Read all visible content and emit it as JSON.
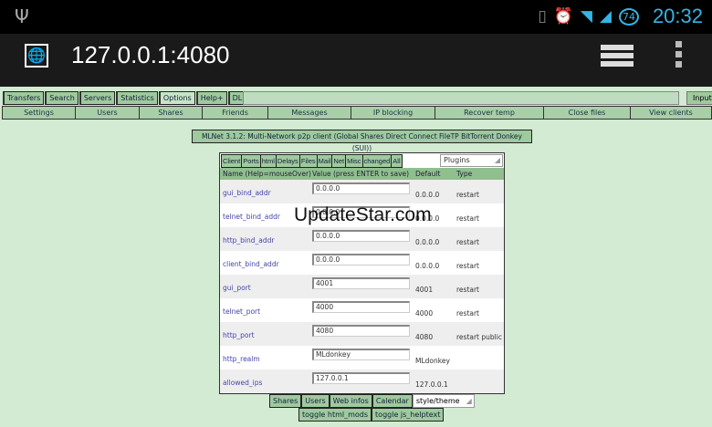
{
  "status": {
    "time": "20:32",
    "battery": "74"
  },
  "browser": {
    "url": "127.0.0.1:4080"
  },
  "nav1": [
    "Transfers",
    "Search",
    "Servers",
    "Statistics",
    "Options",
    "Help+",
    "DL"
  ],
  "input_label": "Input",
  "nav2": [
    "Settings",
    "Users",
    "Shares",
    "Friends",
    "Messages",
    "IP blocking",
    "Recover temp",
    "Close files",
    "View clients"
  ],
  "title": "MLNet 3.1.2: Multi-Network p2p client (Global Shares Direct Connect FileTP BitTorrent Donkey (SUI))",
  "tabs": [
    "Client",
    "Ports",
    "html",
    "Delays",
    "Files",
    "Mail",
    "Net",
    "Misc",
    "changed",
    "All"
  ],
  "plugins_select": "Plugins",
  "headers": {
    "name": "Name (Help=mouseOver)",
    "value": "Value (press ENTER to save)",
    "default": "Default",
    "type": "Type"
  },
  "rows": [
    {
      "name": "gui_bind_addr",
      "value": "0.0.0.0",
      "default": "0.0.0.0",
      "type": "restart"
    },
    {
      "name": "telnet_bind_addr",
      "value": "0.0.0.0",
      "default": "0.0.0.0",
      "type": "restart"
    },
    {
      "name": "http_bind_addr",
      "value": "0.0.0.0",
      "default": "0.0.0.0",
      "type": "restart"
    },
    {
      "name": "client_bind_addr",
      "value": "0.0.0.0",
      "default": "0.0.0.0",
      "type": "restart"
    },
    {
      "name": "gui_port",
      "value": "4001",
      "default": "4001",
      "type": "restart"
    },
    {
      "name": "telnet_port",
      "value": "4000",
      "default": "4000",
      "type": "restart"
    },
    {
      "name": "http_port",
      "value": "4080",
      "default": "4080",
      "type": "restart public"
    },
    {
      "name": "http_realm",
      "value": "MLdonkey",
      "default": "MLdonkey",
      "type": ""
    },
    {
      "name": "allowed_ips",
      "value": "127.0.0.1",
      "default": "127.0.0.1",
      "type": ""
    }
  ],
  "bottom1": [
    "Shares",
    "Users",
    "Web infos",
    "Calendar"
  ],
  "style_select": "style/theme",
  "bottom2": [
    "toggle html_mods",
    "toggle js_helptext"
  ],
  "watermark": "UpdateStar.com"
}
